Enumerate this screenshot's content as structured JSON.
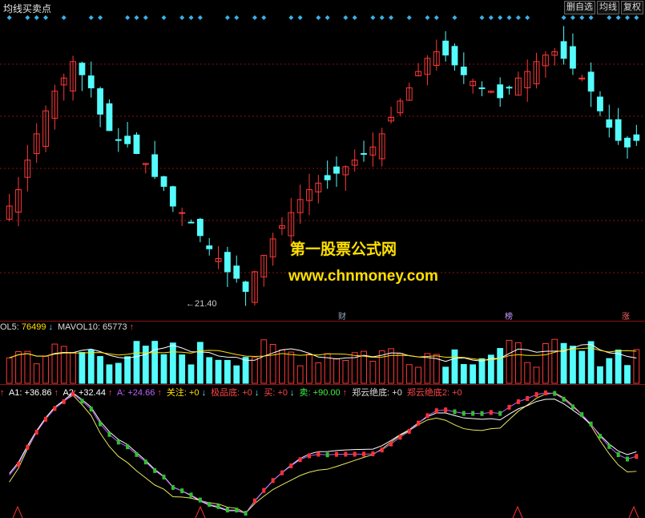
{
  "window": {
    "title": "均线买卖点"
  },
  "toolbar": {
    "buttons": [
      "删自选",
      "均线",
      "复权"
    ]
  },
  "watermark": {
    "line1": "第一股票公式网",
    "line2": "www.chnmoney.com"
  },
  "price_panel": {
    "low_label": "←21.40",
    "markers": [
      "财",
      "榜",
      "涨"
    ]
  },
  "volume_legend": {
    "mavol5_label": "OL5:",
    "mavol5_value": "76499",
    "mavol10_label": "MAVOL10:",
    "mavol10_value": "65773"
  },
  "indicator_legend": {
    "a1": "A1: +36.86",
    "a2": "A2: +32.44",
    "a": "A: +24.66",
    "guanzhu": "关注: +0",
    "jipindi": "极品底: +0",
    "mai": "买: +0",
    "mai2": "卖: +90.00",
    "zhengyun": "郑云绝底: +0",
    "zhengyun2": "郑云绝底2: +0"
  },
  "colors": {
    "up": "#ff3838",
    "down": "#54fcfc",
    "accent": "#ffe000",
    "grid": "#8b1010"
  },
  "chart_data": {
    "type": "candlestick",
    "closes": [
      24.0,
      24.5,
      25.4,
      26.2,
      26.9,
      27.5,
      27.9,
      28.4,
      28.0,
      27.6,
      26.8,
      26.3,
      26.0,
      25.9,
      25.6,
      25.3,
      24.9,
      24.6,
      24.0,
      23.8,
      23.5,
      23.1,
      22.7,
      22.4,
      22.0,
      21.8,
      21.4,
      22.0,
      22.5,
      23.0,
      23.4,
      23.8,
      24.2,
      24.5,
      24.7,
      24.8,
      25.0,
      25.2,
      25.4,
      25.6,
      25.8,
      26.2,
      26.7,
      27.2,
      27.6,
      28.1,
      28.5,
      28.7,
      28.6,
      28.3,
      28.0,
      27.8,
      27.6,
      27.5,
      27.3,
      27.6,
      27.9,
      28.1,
      28.4,
      28.6,
      28.7,
      28.5,
      28.2,
      27.9,
      27.5,
      26.9,
      26.4,
      26.0,
      25.8,
      26.0
    ]
  }
}
